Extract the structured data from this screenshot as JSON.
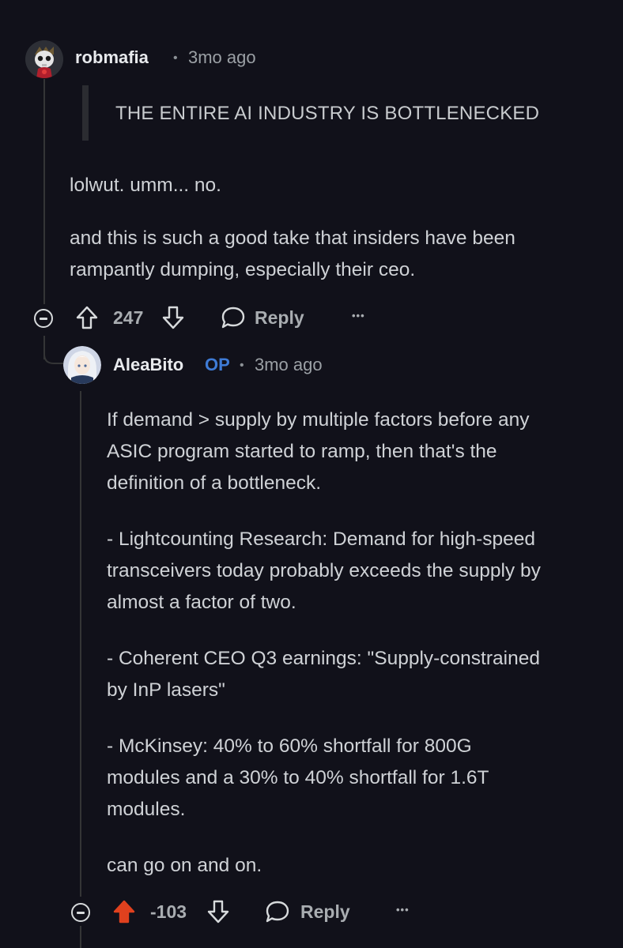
{
  "comment1": {
    "username": "robmafia",
    "separator": "•",
    "time": "3mo ago",
    "quote": "THE ENTIRE AI INDUSTRY IS BOTTLENECKED",
    "paragraphs": [
      "lolwut. umm... no.",
      "and this is such a good take that insiders have been\nrampantly dumping, especially their ceo."
    ],
    "score": "247",
    "reply_label": "Reply",
    "more_label": "•••"
  },
  "comment2": {
    "username": "AleaBito",
    "op_badge": "OP",
    "separator": "•",
    "time": "3mo ago",
    "paragraphs": [
      "If demand > supply by multiple factors before any\nASIC program started to ramp, then that's the\ndefinition of a bottleneck.",
      "- Lightcounting Research: Demand for high-speed\ntransceivers today probably exceeds the supply by\nalmost a factor of two.",
      "- Coherent CEO Q3 earnings: \"Supply-constrained\nby InP lasers\"",
      "- McKinsey: 40% to 60% shortfall for 800G\nmodules and a 30% to 40% shortfall for 1.6T\nmodules.",
      "can go on and on."
    ],
    "score": "-103",
    "reply_label": "Reply",
    "more_label": "•••",
    "upvoted_color": "#e0411e"
  },
  "icons": {
    "collapse": "minus-circle-icon",
    "upvote": "arrow-up-icon",
    "downvote": "arrow-down-icon",
    "reply": "speech-bubble-icon",
    "more": "ellipsis-icon"
  }
}
